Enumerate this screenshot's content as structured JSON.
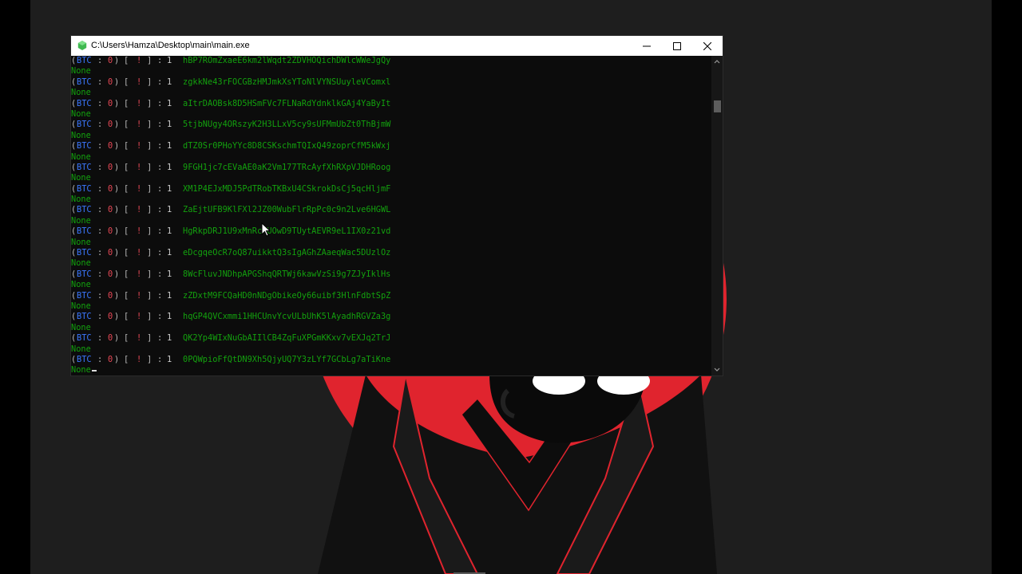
{
  "window": {
    "title": "C:\\Users\\Hamza\\Desktop\\main\\main.exe",
    "icon": "console-app-icon",
    "controls": [
      "minimize-icon",
      "maximize-icon",
      "close-icon"
    ]
  },
  "log": {
    "prefix_open": "(",
    "coin": "BTC",
    "sep": ":",
    "balance": "0",
    "prefix_close": ")",
    "bracket_open": "[",
    "bang": "!",
    "bracket_close": "]",
    "colon": ":",
    "count": "1",
    "result_text": "None",
    "keys": [
      "hBP7ROmZxaeE6km2lWqdt2ZDVHOQichDWlcWWeJgQy",
      "zgkkNe43rFOCGBzHMJmkXsYToNlVYNSUuyleVComxl",
      "aItrDAOBsk8D5HSmFVc7FLNaRdYdnklkGAj4YaByIt",
      "5tjbNUgy4ORszyK2H3LLxV5cy9sUFMmUbZt0ThBjmW",
      "dTZ0Sr0PHoYYc8D8CSKschmTQIxQ49zoprCfM5kWxj",
      "9FGH1jc7cEVaAE0aK2Vm177TRcAyfXhRXpVJDHRoog",
      "XM1P4EJxMDJ5PdTRobTKBxU4CSkrokDsCj5qcHljmF",
      "ZaEjtUFB9KlFXl2JZ00WubFlrRpPc0c9n2Lve6HGWL",
      "HgRkpDRJ1U9xMnRcRUOwD9TUytAEVR9eL1IX0z21vd",
      "eDcgqeOcR7oQ87uikktQ3sIgAGhZAaeqWac5DUzlOz",
      "8WcFluvJNDhpAPGShqQRTWj6kawVzSi9g7ZJyIklHs",
      "zZDxtM9FCQaHD0nNDgObikeOy66uibf3HlnFdbtSpZ",
      "hqGP4QVCxmmi1HHCUnvYcvULbUhK5lAyadhRGVZa3g",
      "QK2Yp4WIxNuGbAIIlCB4ZqFuXPGmKKxv7vEXJq2TrJ",
      "0PQWpioFfQtDN9Xh5QjyUQ7Y3zLYf7GCbLg7aTiKne"
    ]
  },
  "colors": {
    "console_bg": "#0c0c0c",
    "key_green": "#13a10e",
    "coin_blue": "#3b78ff",
    "alert_red": "#e74856",
    "wallpaper_red": "#e0242e"
  },
  "icons": {
    "mouse": "mouse-pointer-icon",
    "scroll_up": "scroll-up-arrow-icon",
    "scroll_down": "scroll-down-arrow-icon"
  }
}
